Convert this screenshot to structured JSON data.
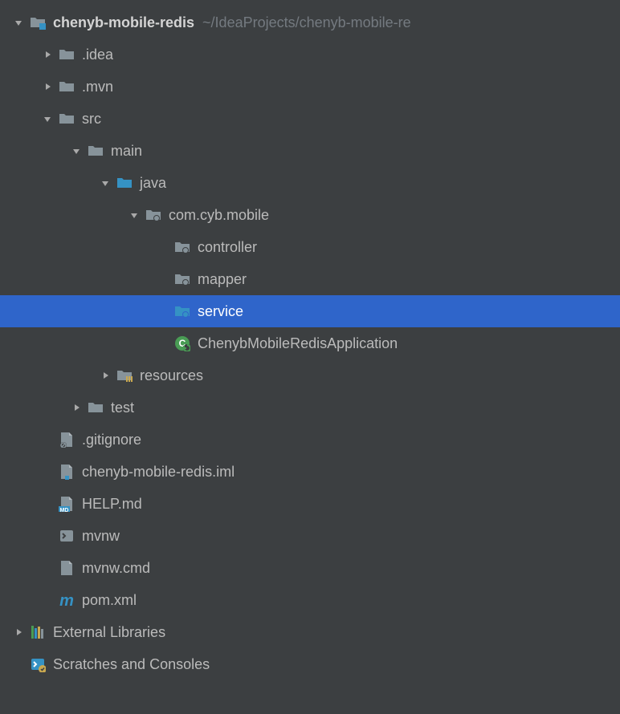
{
  "root": {
    "name": "chenyb-mobile-redis",
    "path": "~/IdeaProjects/chenyb-mobile-re"
  },
  "idea": ".idea",
  "mvn": ".mvn",
  "src": "src",
  "main": "main",
  "java": "java",
  "pkg": "com.cyb.mobile",
  "controller": "controller",
  "mapper": "mapper",
  "service": "service",
  "appClass": "ChenybMobileRedisApplication",
  "resources": "resources",
  "test": "test",
  "gitignore": ".gitignore",
  "iml": "chenyb-mobile-redis.iml",
  "help": "HELP.md",
  "mvnw": "mvnw",
  "mvnwcmd": "mvnw.cmd",
  "pom": "pom.xml",
  "extlib": "External Libraries",
  "scratches": "Scratches and Consoles"
}
